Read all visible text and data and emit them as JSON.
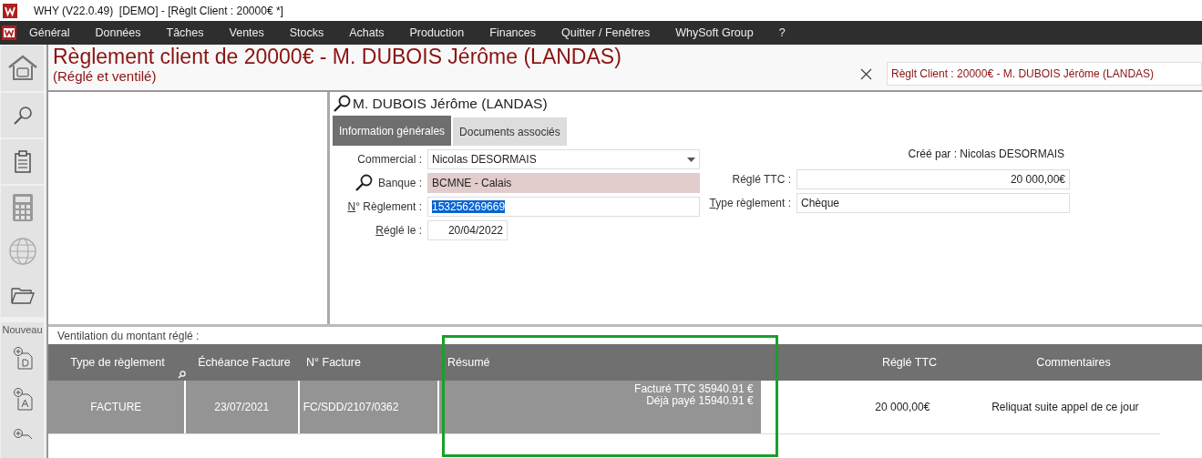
{
  "window": {
    "title": "WHY (V22.0.49)  [DEMO] - [Règlt Client : 20000€ *]"
  },
  "menu": [
    "Général",
    "Données",
    "Tâches",
    "Ventes",
    "Stocks",
    "Achats",
    "Production",
    "Finances",
    "Quitter / Fenêtres",
    "WhySoft Group",
    "?"
  ],
  "sidebar": {
    "section_label": "Nouveau"
  },
  "header": {
    "title": "Règlement client de 20000€ - M. DUBOIS Jérôme (LANDAS)",
    "subtitle": "(Réglé et ventilé)",
    "open_window": "Règlt Client : 20000€ - M. DUBOIS Jérôme (LANDAS)"
  },
  "client": {
    "name": "M. DUBOIS Jérôme (LANDAS)"
  },
  "tabs": [
    {
      "label": "Information générales",
      "selected": true
    },
    {
      "label": "Documents associés",
      "selected": false
    }
  ],
  "created_by": "Créé par : Nicolas DESORMAIS",
  "fields_left": [
    {
      "label": "Commercial :",
      "value": "Nicolas DESORMAIS",
      "kind": "dropdown",
      "underline_first": false
    },
    {
      "label": "Banque :",
      "value": "BCMNE - Calais",
      "kind": "lookup",
      "underline_first": false
    },
    {
      "label": "N° Règlement :",
      "value": "153256269669",
      "kind": "selected",
      "underline_first": true
    },
    {
      "label": "Réglé le :",
      "value": "20/04/2022",
      "kind": "date",
      "underline_first": true
    }
  ],
  "fields_right": [
    {
      "label": "Réglé TTC :",
      "value": "20 000,00€",
      "kind": "amount",
      "underline_first": false
    },
    {
      "label": "Type règlement :",
      "value": "Chèque",
      "kind": "text",
      "underline_first": true
    }
  ],
  "ventilation": {
    "label": "Ventilation du montant réglé :",
    "columns": [
      {
        "label": "Type de règlement",
        "highlighted": false
      },
      {
        "label": "Échéance Facture",
        "highlighted": false
      },
      {
        "label": "N° Facture",
        "highlighted": false
      },
      {
        "label": "Résumé",
        "highlighted": true
      },
      {
        "label": "Réglé TTC",
        "highlighted": false
      },
      {
        "label": "Commentaires",
        "highlighted": false
      }
    ],
    "rows": [
      {
        "selected": true,
        "type": "FACTURE",
        "due": "23/07/2021",
        "invoice": "FC/SDD/2107/0362",
        "summary": [
          "Facturé TTC 35940.91 €",
          "Déjà payé 15940.91 €"
        ],
        "paid": "20 000,00€",
        "comment": "Reliquat suite appel de ce jour"
      }
    ]
  }
}
